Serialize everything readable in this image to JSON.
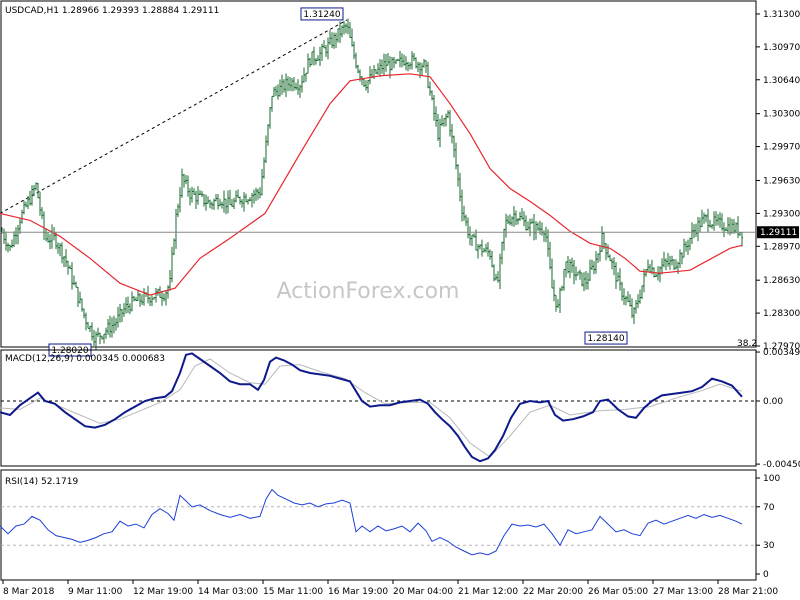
{
  "chart_data": [
    {
      "type": "ohlc",
      "symbol": "USDCAD,H1",
      "ohlc_header": [
        "1.28966",
        "1.29393",
        "1.28884",
        "1.29111"
      ],
      "watermark": "ActionForex.com",
      "ylim": [
        1.2797,
        1.3142
      ],
      "y_ticks": [
        "1.31300",
        "1.30970",
        "1.30640",
        "1.30300",
        "1.29970",
        "1.29630",
        "1.29300",
        "1.28970",
        "1.28630",
        "1.28300",
        "1.27970"
      ],
      "last_price": "1.29111",
      "price_annotations": [
        "1.31240",
        "1.28020",
        "1.28140"
      ],
      "corner_label": "38.2",
      "x_ticks": [
        "8 Mar 2018",
        "9 Mar 11:00",
        "12 Mar 19:00",
        "14 Mar 03:00",
        "15 Mar 11:00",
        "16 Mar 19:00",
        "20 Mar 04:00",
        "21 Mar 12:00",
        "22 Mar 20:00",
        "26 Mar 05:00",
        "27 Mar 13:00",
        "28 Mar 21:00"
      ],
      "close_path": [
        [
          0,
          1.2915
        ],
        [
          10,
          1.2895
        ],
        [
          20,
          1.2925
        ],
        [
          30,
          1.2945
        ],
        [
          36,
          1.2958
        ],
        [
          45,
          1.2905
        ],
        [
          55,
          1.2905
        ],
        [
          65,
          1.2885
        ],
        [
          75,
          1.2855
        ],
        [
          85,
          1.2825
        ],
        [
          95,
          1.2805
        ],
        [
          105,
          1.2812
        ],
        [
          115,
          1.282
        ],
        [
          125,
          1.2835
        ],
        [
          135,
          1.2842
        ],
        [
          145,
          1.2845
        ],
        [
          155,
          1.2848
        ],
        [
          165,
          1.285
        ],
        [
          170,
          1.286
        ],
        [
          175,
          1.292
        ],
        [
          182,
          1.2965
        ],
        [
          190,
          1.295
        ],
        [
          200,
          1.2945
        ],
        [
          210,
          1.294
        ],
        [
          220,
          1.2945
        ],
        [
          230,
          1.2938
        ],
        [
          240,
          1.2945
        ],
        [
          250,
          1.2948
        ],
        [
          260,
          1.2952
        ],
        [
          265,
          1.299
        ],
        [
          272,
          1.305
        ],
        [
          280,
          1.3055
        ],
        [
          290,
          1.3062
        ],
        [
          300,
          1.306
        ],
        [
          310,
          1.3085
        ],
        [
          320,
          1.309
        ],
        [
          330,
          1.31
        ],
        [
          340,
          1.3112
        ],
        [
          347,
          1.3118
        ],
        [
          352,
          1.3095
        ],
        [
          358,
          1.3075
        ],
        [
          365,
          1.306
        ],
        [
          375,
          1.307
        ],
        [
          385,
          1.308
        ],
        [
          395,
          1.3078
        ],
        [
          405,
          1.3085
        ],
        [
          415,
          1.3082
        ],
        [
          425,
          1.3078
        ],
        [
          432,
          1.304
        ],
        [
          438,
          1.301
        ],
        [
          448,
          1.303
        ],
        [
          455,
          1.2985
        ],
        [
          462,
          1.2935
        ],
        [
          470,
          1.2905
        ],
        [
          480,
          1.2895
        ],
        [
          490,
          1.289
        ],
        [
          497,
          1.2855
        ],
        [
          505,
          1.292
        ],
        [
          515,
          1.293
        ],
        [
          525,
          1.292
        ],
        [
          535,
          1.2915
        ],
        [
          545,
          1.2915
        ],
        [
          552,
          1.2855
        ],
        [
          558,
          1.2835
        ],
        [
          565,
          1.288
        ],
        [
          575,
          1.287
        ],
        [
          585,
          1.286
        ],
        [
          595,
          1.288
        ],
        [
          602,
          1.2905
        ],
        [
          610,
          1.2885
        ],
        [
          620,
          1.2855
        ],
        [
          628,
          1.284
        ],
        [
          633,
          1.2826
        ],
        [
          640,
          1.285
        ],
        [
          648,
          1.288
        ],
        [
          655,
          1.287
        ],
        [
          665,
          1.288
        ],
        [
          675,
          1.288
        ],
        [
          685,
          1.2895
        ],
        [
          695,
          1.2915
        ],
        [
          705,
          1.2925
        ],
        [
          715,
          1.292
        ],
        [
          725,
          1.2918
        ],
        [
          735,
          1.2915
        ],
        [
          742,
          1.2911
        ]
      ],
      "ma_path": [
        [
          0,
          1.293
        ],
        [
          30,
          1.2923
        ],
        [
          60,
          1.2907
        ],
        [
          90,
          1.2885
        ],
        [
          120,
          1.286
        ],
        [
          150,
          1.2848
        ],
        [
          175,
          1.2855
        ],
        [
          200,
          1.2885
        ],
        [
          230,
          1.2905
        ],
        [
          265,
          1.293
        ],
        [
          300,
          1.299
        ],
        [
          330,
          1.304
        ],
        [
          350,
          1.3063
        ],
        [
          380,
          1.3068
        ],
        [
          410,
          1.307
        ],
        [
          430,
          1.3067
        ],
        [
          450,
          1.304
        ],
        [
          470,
          1.301
        ],
        [
          490,
          1.2975
        ],
        [
          510,
          1.2955
        ],
        [
          530,
          1.2942
        ],
        [
          550,
          1.2928
        ],
        [
          570,
          1.2912
        ],
        [
          590,
          1.29
        ],
        [
          610,
          1.2895
        ],
        [
          625,
          1.2885
        ],
        [
          640,
          1.2872
        ],
        [
          660,
          1.287
        ],
        [
          690,
          1.2873
        ],
        [
          710,
          1.2884
        ],
        [
          730,
          1.2895
        ],
        [
          742,
          1.2898
        ]
      ],
      "trendline": [
        [
          0,
          1.293
        ],
        [
          347,
          1.3124
        ]
      ]
    },
    {
      "type": "line",
      "title": "MACD(12,26,9)",
      "values_label": [
        "0.000345",
        "0.000683"
      ],
      "ylim": [
        -0.0045,
        0.0035
      ],
      "y_ticks": [
        "0.003497",
        "0.00",
        "-0.004508"
      ],
      "macd_path": [
        [
          0,
          -0.0008
        ],
        [
          10,
          -0.001
        ],
        [
          20,
          -0.0003
        ],
        [
          30,
          0.0002
        ],
        [
          38,
          0.0006
        ],
        [
          45,
          0.0
        ],
        [
          55,
          -0.0002
        ],
        [
          65,
          -0.0008
        ],
        [
          75,
          -0.0013
        ],
        [
          85,
          -0.0018
        ],
        [
          95,
          -0.0019
        ],
        [
          105,
          -0.0017
        ],
        [
          115,
          -0.0013
        ],
        [
          125,
          -0.0008
        ],
        [
          135,
          -0.0004
        ],
        [
          145,
          0.0
        ],
        [
          155,
          0.0002
        ],
        [
          165,
          0.0003
        ],
        [
          172,
          0.0007
        ],
        [
          180,
          0.002
        ],
        [
          186,
          0.0033
        ],
        [
          192,
          0.0034
        ],
        [
          200,
          0.003
        ],
        [
          210,
          0.0025
        ],
        [
          220,
          0.002
        ],
        [
          230,
          0.0014
        ],
        [
          240,
          0.0012
        ],
        [
          250,
          0.0012
        ],
        [
          258,
          0.0008
        ],
        [
          264,
          0.0015
        ],
        [
          270,
          0.0028
        ],
        [
          276,
          0.0031
        ],
        [
          284,
          0.0029
        ],
        [
          292,
          0.0026
        ],
        [
          300,
          0.0022
        ],
        [
          310,
          0.002
        ],
        [
          320,
          0.0019
        ],
        [
          330,
          0.0018
        ],
        [
          340,
          0.0016
        ],
        [
          350,
          0.0014
        ],
        [
          356,
          0.0007
        ],
        [
          362,
          0.0
        ],
        [
          370,
          -0.0004
        ],
        [
          380,
          -0.0003
        ],
        [
          390,
          -0.0003
        ],
        [
          400,
          -0.0001
        ],
        [
          410,
          0.0
        ],
        [
          420,
          0.0001
        ],
        [
          428,
          -0.0002
        ],
        [
          435,
          -0.0008
        ],
        [
          442,
          -0.0013
        ],
        [
          450,
          -0.0018
        ],
        [
          458,
          -0.0025
        ],
        [
          465,
          -0.0033
        ],
        [
          472,
          -0.004
        ],
        [
          480,
          -0.0043
        ],
        [
          488,
          -0.0041
        ],
        [
          495,
          -0.0035
        ],
        [
          503,
          -0.0025
        ],
        [
          511,
          -0.0012
        ],
        [
          520,
          -0.0002
        ],
        [
          530,
          0.0
        ],
        [
          540,
          -0.0001
        ],
        [
          548,
          0.0
        ],
        [
          555,
          -0.001
        ],
        [
          563,
          -0.0014
        ],
        [
          573,
          -0.0013
        ],
        [
          583,
          -0.0011
        ],
        [
          593,
          -0.0008
        ],
        [
          600,
          0.0
        ],
        [
          608,
          0.0001
        ],
        [
          618,
          -0.0006
        ],
        [
          628,
          -0.0011
        ],
        [
          636,
          -0.0012
        ],
        [
          644,
          -0.0005
        ],
        [
          652,
          0.0
        ],
        [
          662,
          0.0004
        ],
        [
          672,
          0.0005
        ],
        [
          682,
          0.0006
        ],
        [
          692,
          0.0007
        ],
        [
          702,
          0.001
        ],
        [
          712,
          0.0016
        ],
        [
          722,
          0.0014
        ],
        [
          732,
          0.0011
        ],
        [
          742,
          0.0003
        ]
      ],
      "signal_path": [
        [
          0,
          -0.0005
        ],
        [
          20,
          -0.0006
        ],
        [
          40,
          0.0002
        ],
        [
          60,
          -0.0004
        ],
        [
          80,
          -0.001
        ],
        [
          100,
          -0.0016
        ],
        [
          120,
          -0.0013
        ],
        [
          140,
          -0.0007
        ],
        [
          160,
          -0.0001
        ],
        [
          180,
          0.0008
        ],
        [
          195,
          0.0025
        ],
        [
          210,
          0.003
        ],
        [
          230,
          0.002
        ],
        [
          250,
          0.0013
        ],
        [
          265,
          0.0012
        ],
        [
          280,
          0.0025
        ],
        [
          300,
          0.0026
        ],
        [
          320,
          0.0021
        ],
        [
          345,
          0.0016
        ],
        [
          365,
          0.0006
        ],
        [
          385,
          -0.0002
        ],
        [
          410,
          -0.0001
        ],
        [
          430,
          -0.0001
        ],
        [
          450,
          -0.0012
        ],
        [
          470,
          -0.003
        ],
        [
          490,
          -0.004
        ],
        [
          510,
          -0.0025
        ],
        [
          530,
          -0.0008
        ],
        [
          550,
          -0.0003
        ],
        [
          570,
          -0.001
        ],
        [
          600,
          -0.0007
        ],
        [
          625,
          -0.0006
        ],
        [
          650,
          -0.0004
        ],
        [
          680,
          0.0003
        ],
        [
          700,
          0.0007
        ],
        [
          720,
          0.0012
        ],
        [
          742,
          0.0007
        ]
      ]
    },
    {
      "type": "line",
      "title": "RSI(14)",
      "value_label": "52.1719",
      "ylim": [
        0,
        100
      ],
      "y_ticks": [
        "100",
        "70",
        "30",
        "0"
      ],
      "levels": [
        70,
        30
      ],
      "rsi_path": [
        [
          0,
          50
        ],
        [
          8,
          42
        ],
        [
          16,
          50
        ],
        [
          24,
          52
        ],
        [
          32,
          60
        ],
        [
          40,
          56
        ],
        [
          48,
          46
        ],
        [
          56,
          40
        ],
        [
          64,
          38
        ],
        [
          72,
          36
        ],
        [
          80,
          33
        ],
        [
          88,
          35
        ],
        [
          96,
          38
        ],
        [
          104,
          42
        ],
        [
          112,
          44
        ],
        [
          120,
          55
        ],
        [
          128,
          50
        ],
        [
          136,
          52
        ],
        [
          144,
          48
        ],
        [
          152,
          62
        ],
        [
          160,
          68
        ],
        [
          168,
          63
        ],
        [
          174,
          56
        ],
        [
          180,
          82
        ],
        [
          186,
          76
        ],
        [
          192,
          70
        ],
        [
          200,
          72
        ],
        [
          210,
          66
        ],
        [
          220,
          62
        ],
        [
          230,
          59
        ],
        [
          240,
          62
        ],
        [
          250,
          58
        ],
        [
          260,
          60
        ],
        [
          266,
          78
        ],
        [
          272,
          88
        ],
        [
          278,
          82
        ],
        [
          286,
          78
        ],
        [
          294,
          74
        ],
        [
          302,
          72
        ],
        [
          310,
          74
        ],
        [
          318,
          70
        ],
        [
          326,
          73
        ],
        [
          334,
          74
        ],
        [
          342,
          77
        ],
        [
          350,
          74
        ],
        [
          356,
          44
        ],
        [
          362,
          50
        ],
        [
          370,
          44
        ],
        [
          378,
          50
        ],
        [
          386,
          45
        ],
        [
          394,
          47
        ],
        [
          402,
          50
        ],
        [
          410,
          44
        ],
        [
          418,
          53
        ],
        [
          426,
          45
        ],
        [
          432,
          34
        ],
        [
          440,
          38
        ],
        [
          448,
          34
        ],
        [
          456,
          28
        ],
        [
          464,
          24
        ],
        [
          472,
          20
        ],
        [
          480,
          22
        ],
        [
          488,
          20
        ],
        [
          496,
          24
        ],
        [
          504,
          40
        ],
        [
          512,
          52
        ],
        [
          520,
          50
        ],
        [
          528,
          51
        ],
        [
          536,
          49
        ],
        [
          544,
          52
        ],
        [
          552,
          42
        ],
        [
          560,
          30
        ],
        [
          568,
          46
        ],
        [
          576,
          42
        ],
        [
          584,
          44
        ],
        [
          592,
          46
        ],
        [
          600,
          60
        ],
        [
          608,
          52
        ],
        [
          616,
          44
        ],
        [
          624,
          46
        ],
        [
          632,
          42
        ],
        [
          640,
          40
        ],
        [
          648,
          53
        ],
        [
          656,
          56
        ],
        [
          664,
          52
        ],
        [
          672,
          55
        ],
        [
          680,
          58
        ],
        [
          688,
          61
        ],
        [
          696,
          58
        ],
        [
          704,
          62
        ],
        [
          712,
          59
        ],
        [
          720,
          61
        ],
        [
          728,
          58
        ],
        [
          736,
          55
        ],
        [
          742,
          52
        ]
      ]
    }
  ]
}
